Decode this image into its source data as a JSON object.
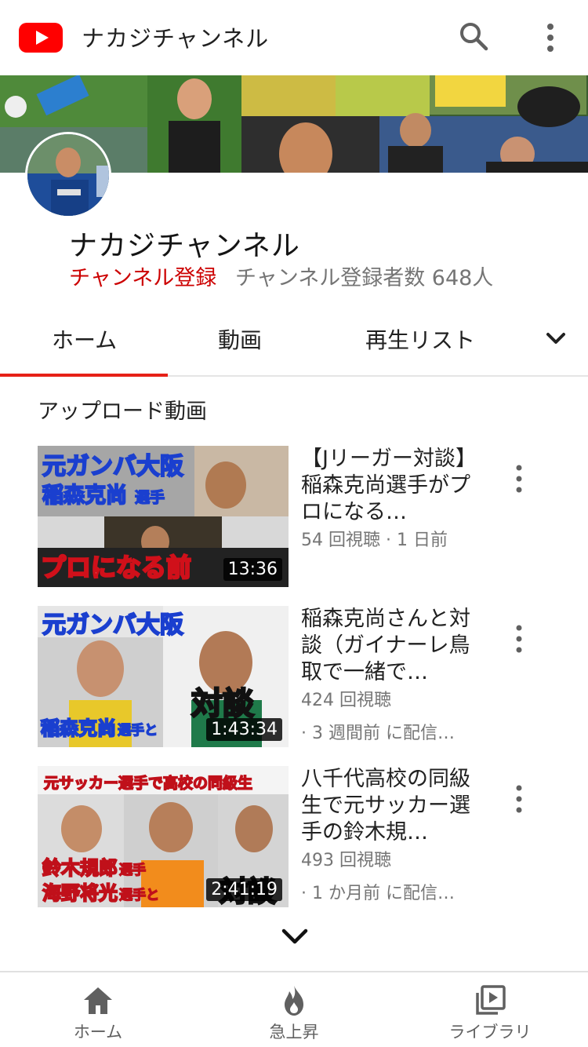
{
  "header": {
    "title": "ナカジチャンネル",
    "logo_color": "#ff0000",
    "search_icon": "search-icon",
    "more_icon": "more-vert-icon"
  },
  "channel": {
    "name": "ナカジチャンネル",
    "subscribe_label": "チャンネル登録",
    "subscriber_count": "チャンネル登録者数 648人",
    "subscribe_color": "#cc0000"
  },
  "tabs": {
    "items": [
      {
        "label": "ホーム",
        "active": true
      },
      {
        "label": "動画",
        "active": false
      },
      {
        "label": "再生リスト",
        "active": false
      }
    ],
    "accent_color": "#e62117",
    "more_icon": "chevron-down-icon"
  },
  "section": {
    "title": "アップロード動画"
  },
  "videos": [
    {
      "title": "【Jリーガー対談】稲森克尚選手がプロになる…",
      "meta": "54 回視聴 · 1 日前",
      "meta2": "",
      "duration": "13:36",
      "thumb_text_1": "元ガンバ大阪",
      "thumb_text_2": "稲森克尚",
      "thumb_text_2b": "選手",
      "thumb_text_3": "プロになる前"
    },
    {
      "title": "稲森克尚さんと対談（ガイナーレ鳥取で一緒で…",
      "meta": "424 回視聴",
      "meta2": "· 3 週間前 に配信済み",
      "duration": "1:43:34",
      "thumb_text_1": "元ガンバ大阪",
      "thumb_text_2": "稲森克尚",
      "thumb_text_2b": "選手と",
      "thumb_text_3": "対談"
    },
    {
      "title": "八千代高校の同級生で元サッカー選手の鈴木規…",
      "meta": "493 回視聴",
      "meta2": "· 1 か月前 に配信済み",
      "duration": "2:41:19",
      "thumb_text_1": "元サッカー選手で高校の同級生",
      "thumb_text_2": "鈴木規郎",
      "thumb_text_2b": "選手",
      "thumb_text_3": "海野将光",
      "thumb_text_3b": "選手と",
      "thumb_text_4": "対談"
    }
  ],
  "bottom_nav": [
    {
      "label": "ホーム",
      "icon": "home-icon"
    },
    {
      "label": "急上昇",
      "icon": "flame-icon"
    },
    {
      "label": "ライブラリ",
      "icon": "library-icon"
    }
  ]
}
